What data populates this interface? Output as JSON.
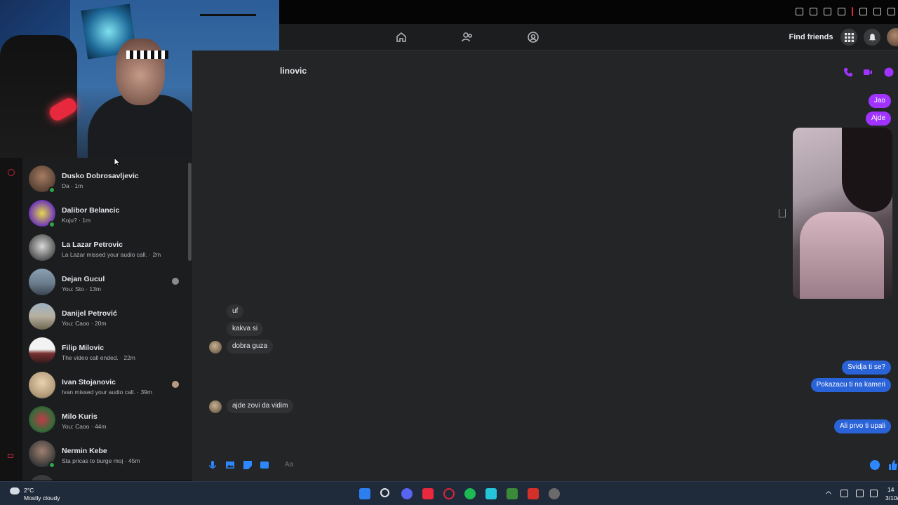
{
  "navbar": {
    "find_friends_label": "Find friends",
    "icons": [
      "home-icon",
      "friends-icon",
      "groups-icon",
      "menu-grid-icon",
      "bell-icon",
      "profile-avatar"
    ]
  },
  "conversation": {
    "title": "linovic",
    "header_icons": [
      "phone-icon",
      "video-icon",
      "info-icon"
    ],
    "messages": [
      {
        "dir": "out",
        "text": "Jao"
      },
      {
        "dir": "out",
        "text": "Ajde"
      },
      {
        "dir": "in",
        "text": "uf"
      },
      {
        "dir": "in",
        "text": "kakva si"
      },
      {
        "dir": "in",
        "text": "dobra guza"
      },
      {
        "dir": "out",
        "text": "Svidja ti se?"
      },
      {
        "dir": "out",
        "text": "Pokazacu ti na kameri"
      },
      {
        "dir": "in",
        "text": "ajde zovi da vidim"
      },
      {
        "dir": "out",
        "text": "Ali prvo ti upali"
      }
    ],
    "composer_placeholder": "Aa"
  },
  "chats": [
    {
      "name": "Dusko Dobrosavljevic",
      "preview": "Da · 1m",
      "online": true,
      "seen": false
    },
    {
      "name": "Dalibor Belancic",
      "preview": "Koju? · 1m",
      "online": true,
      "seen": false
    },
    {
      "name": "La Lazar Petrovic",
      "preview": "La Lazar missed your audio call. · 2m",
      "online": false,
      "seen": false
    },
    {
      "name": "Dejan Gucul",
      "preview": "You: Sto · 13m",
      "online": false,
      "seen": true
    },
    {
      "name": "Danijel Petrović",
      "preview": "You: Caoo · 20m",
      "online": false,
      "seen": false
    },
    {
      "name": "Filip Milovic",
      "preview": "The video call ended. · 22m",
      "online": false,
      "seen": false
    },
    {
      "name": "Ivan Stojanovic",
      "preview": "Ivan missed your audio call. · 39m",
      "online": false,
      "seen": true
    },
    {
      "name": "Milo Kuris",
      "preview": "You: Caoo · 44m",
      "online": false,
      "seen": false
    },
    {
      "name": "Nermin Kebe",
      "preview": "Sta pricas to burge moj · 45m",
      "online": true,
      "seen": false
    }
  ],
  "taskbar": {
    "weather_temp": "2°C",
    "weather_desc": "Mostly cloudy",
    "clock_time": "14",
    "clock_date": "3/10/"
  },
  "colors": {
    "accent_purple": "#a033ff",
    "accent_blue": "#2d88ff",
    "outgoing_bubble": "#2a62d8",
    "online_green": "#31a24c"
  }
}
